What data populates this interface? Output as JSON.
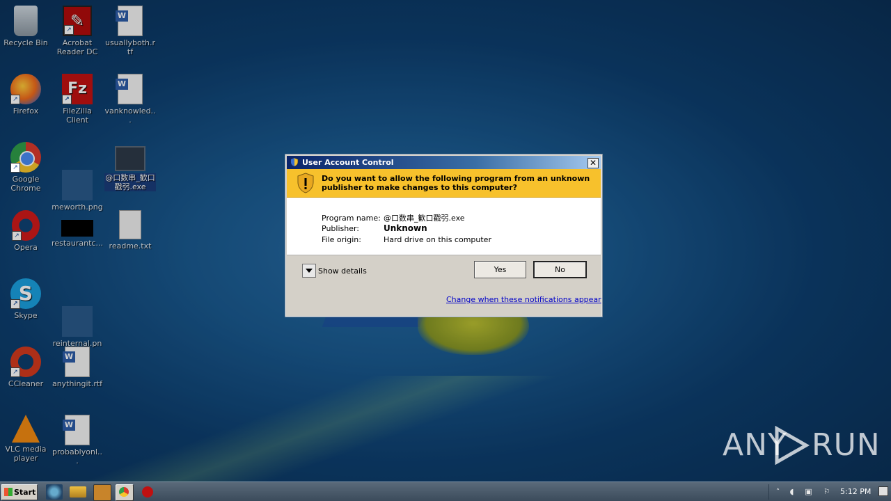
{
  "desktop": {
    "icons": [
      {
        "label": "Recycle Bin"
      },
      {
        "label": "Acrobat Reader DC"
      },
      {
        "label": "usuallyboth.rtf"
      },
      {
        "label": "Firefox"
      },
      {
        "label": "FileZilla Client"
      },
      {
        "label": "vanknowled..."
      },
      {
        "label": "Google Chrome"
      },
      {
        "label": "meworth.png"
      },
      {
        "label": "@口数串_歓口戳弜.exe"
      },
      {
        "label": "Opera"
      },
      {
        "label": "restaurantc..."
      },
      {
        "label": "readme.txt"
      },
      {
        "label": "Skype"
      },
      {
        "label": "reinternal.png"
      },
      {
        "label": "CCleaner"
      },
      {
        "label": "anythingit.rtf"
      },
      {
        "label": "VLC media player"
      },
      {
        "label": "probablyonl..."
      }
    ]
  },
  "uac": {
    "title": "User Account Control",
    "close_label": "✕",
    "question": "Do you want to allow the following program from an unknown publisher to make changes to this computer?",
    "program_name_label": "Program name:",
    "program_name_value": "@口数串_歓口戳弜.exe",
    "publisher_label": "Publisher:",
    "publisher_value": "Unknown",
    "file_origin_label": "File origin:",
    "file_origin_value": "Hard drive on this computer",
    "show_details_label": "Show details",
    "yes_label": "Yes",
    "no_label": "No",
    "change_link": "Change when these notifications appear"
  },
  "taskbar": {
    "start_label": "Start",
    "clock": "5:12 PM"
  },
  "watermark": {
    "left": "ANY",
    "right": "RUN"
  },
  "colors": {
    "banner": "#f7c12c",
    "titlebar": "#0a246a",
    "link": "#0000c8"
  }
}
